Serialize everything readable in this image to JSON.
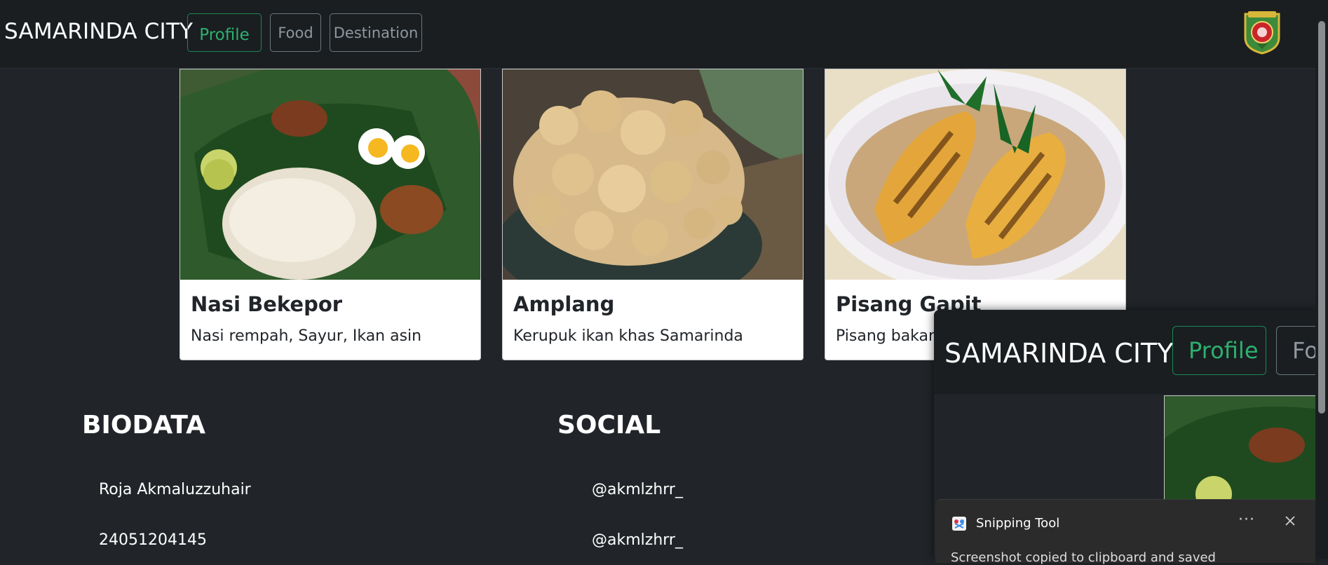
{
  "navbar": {
    "brand": "SAMARINDA CITY",
    "buttons": [
      {
        "label": "Profile",
        "active": true
      },
      {
        "label": "Food",
        "active": false
      },
      {
        "label": "Destination",
        "active": false
      }
    ],
    "logo_icon": "city-emblem-icon"
  },
  "cards": [
    {
      "title": "Nasi Bekepor",
      "text": "Nasi rempah, Sayur, Ikan asin",
      "image_icon": "nasi-bekepor-photo"
    },
    {
      "title": "Amplang",
      "text": "Kerupuk ikan khas Samarinda",
      "image_icon": "amplang-photo"
    },
    {
      "title": "Pisang Gapit",
      "text": "Pisang bakar,",
      "image_icon": "pisang-gapit-photo"
    }
  ],
  "biodata": {
    "heading": "BIODATA",
    "items": [
      "Roja Akmaluzzuhair",
      "24051204145"
    ]
  },
  "social": {
    "heading": "SOCIAL",
    "items": [
      "@akmlzhrr_",
      "@akmlzhrr_"
    ]
  },
  "preview": {
    "brand": "SAMARINDA CITY",
    "buttons": [
      "Profile",
      "Foo"
    ]
  },
  "toast": {
    "title": "Snipping Tool",
    "more": "···",
    "body": "Screenshot copied to clipboard and saved"
  },
  "colors": {
    "background": "#212529",
    "navbar": "#1a1e21",
    "accent_green": "#198754",
    "card_bg": "#ffffff"
  }
}
